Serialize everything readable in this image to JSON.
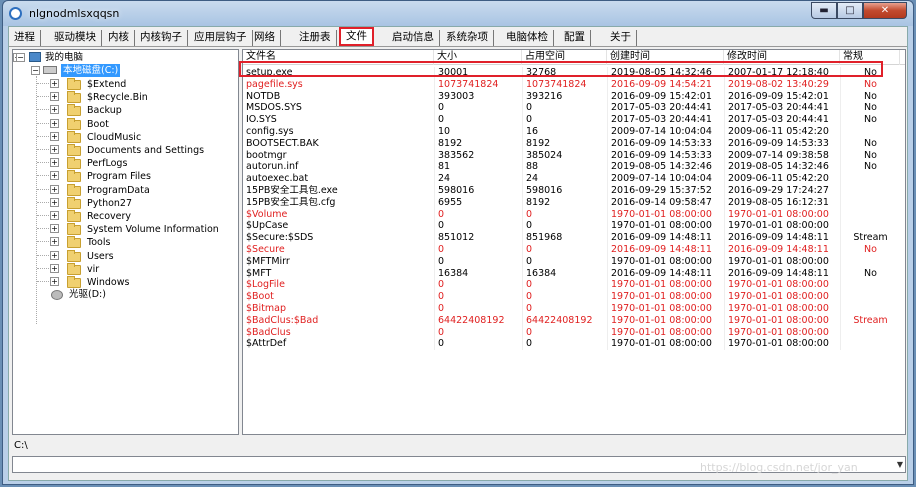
{
  "window": {
    "title": "nlgnodmlsxqqsn",
    "ctrl_min": "▬",
    "ctrl_max": "□",
    "ctrl_close": "✕"
  },
  "tabs": [
    "进程",
    "驱动模块",
    "内核",
    "内核钩子",
    "应用层钩子",
    "网络",
    "注册表",
    "文件",
    "启动信息",
    "系统杂项",
    "电脑体检",
    "配置",
    "关于"
  ],
  "active_tab": "文件",
  "tree": {
    "root": "我的电脑",
    "drive": "本地磁盘(C:)",
    "folders": [
      "$Extend",
      "$Recycle.Bin",
      "Backup",
      "Boot",
      "CloudMusic",
      "Documents and Settings",
      "PerfLogs",
      "Program Files",
      "ProgramData",
      "Python27",
      "Recovery",
      "System Volume Information",
      "Tools",
      "Users",
      "vir",
      "Windows"
    ],
    "cdrom": "光驱(D:)"
  },
  "columns": [
    "文件名",
    "大小",
    "占用空间",
    "创建时间",
    "修改时间",
    "常规"
  ],
  "files": [
    {
      "name": "setup.exe",
      "size": "30001",
      "space": "32768",
      "created": "2019-08-05 14:32:46",
      "modified": "2007-01-17 12:18:40",
      "normal": "No",
      "red": false
    },
    {
      "name": "pagefile.sys",
      "size": "1073741824",
      "space": "1073741824",
      "created": "2016-09-09 14:54:21",
      "modified": "2019-08-02 13:40:29",
      "normal": "No",
      "red": true
    },
    {
      "name": "NOTDB",
      "size": "393003",
      "space": "393216",
      "created": "2016-09-09 15:42:01",
      "modified": "2016-09-09 15:42:01",
      "normal": "No",
      "red": false
    },
    {
      "name": "MSDOS.SYS",
      "size": "0",
      "space": "0",
      "created": "2017-05-03 20:44:41",
      "modified": "2017-05-03 20:44:41",
      "normal": "No",
      "red": false
    },
    {
      "name": "IO.SYS",
      "size": "0",
      "space": "0",
      "created": "2017-05-03 20:44:41",
      "modified": "2017-05-03 20:44:41",
      "normal": "No",
      "red": false
    },
    {
      "name": "config.sys",
      "size": "10",
      "space": "16",
      "created": "2009-07-14 10:04:04",
      "modified": "2009-06-11 05:42:20",
      "normal": "",
      "red": false
    },
    {
      "name": "BOOTSECT.BAK",
      "size": "8192",
      "space": "8192",
      "created": "2016-09-09 14:53:33",
      "modified": "2016-09-09 14:53:33",
      "normal": "No",
      "red": false
    },
    {
      "name": "bootmgr",
      "size": "383562",
      "space": "385024",
      "created": "2016-09-09 14:53:33",
      "modified": "2009-07-14 09:38:58",
      "normal": "No",
      "red": false
    },
    {
      "name": "autorun.inf",
      "size": "81",
      "space": "88",
      "created": "2019-08-05 14:32:46",
      "modified": "2019-08-05 14:32:46",
      "normal": "No",
      "red": false
    },
    {
      "name": "autoexec.bat",
      "size": "24",
      "space": "24",
      "created": "2009-07-14 10:04:04",
      "modified": "2009-06-11 05:42:20",
      "normal": "",
      "red": false
    },
    {
      "name": "15PB安全工具包.exe",
      "size": "598016",
      "space": "598016",
      "created": "2016-09-29 15:37:52",
      "modified": "2016-09-29 17:24:27",
      "normal": "",
      "red": false
    },
    {
      "name": "15PB安全工具包.cfg",
      "size": "6955",
      "space": "8192",
      "created": "2016-09-14 09:58:47",
      "modified": "2019-08-05 16:12:31",
      "normal": "",
      "red": false
    },
    {
      "name": "$Volume",
      "size": "0",
      "space": "0",
      "created": "1970-01-01 08:00:00",
      "modified": "1970-01-01 08:00:00",
      "normal": "",
      "red": true
    },
    {
      "name": "$UpCase",
      "size": "0",
      "space": "0",
      "created": "1970-01-01 08:00:00",
      "modified": "1970-01-01 08:00:00",
      "normal": "",
      "red": false
    },
    {
      "name": "$Secure:$SDS",
      "size": "851012",
      "space": "851968",
      "created": "2016-09-09 14:48:11",
      "modified": "2016-09-09 14:48:11",
      "normal": "Stream",
      "red": false
    },
    {
      "name": "$Secure",
      "size": "0",
      "space": "0",
      "created": "2016-09-09 14:48:11",
      "modified": "2016-09-09 14:48:11",
      "normal": "No",
      "red": true
    },
    {
      "name": "$MFTMirr",
      "size": "0",
      "space": "0",
      "created": "1970-01-01 08:00:00",
      "modified": "1970-01-01 08:00:00",
      "normal": "",
      "red": false
    },
    {
      "name": "$MFT",
      "size": "16384",
      "space": "16384",
      "created": "2016-09-09 14:48:11",
      "modified": "2016-09-09 14:48:11",
      "normal": "No",
      "red": false
    },
    {
      "name": "$LogFile",
      "size": "0",
      "space": "0",
      "created": "1970-01-01 08:00:00",
      "modified": "1970-01-01 08:00:00",
      "normal": "",
      "red": true
    },
    {
      "name": "$Boot",
      "size": "0",
      "space": "0",
      "created": "1970-01-01 08:00:00",
      "modified": "1970-01-01 08:00:00",
      "normal": "",
      "red": true
    },
    {
      "name": "$Bitmap",
      "size": "0",
      "space": "0",
      "created": "1970-01-01 08:00:00",
      "modified": "1970-01-01 08:00:00",
      "normal": "",
      "red": true
    },
    {
      "name": "$BadClus:$Bad",
      "size": "64422408192",
      "space": "64422408192",
      "created": "1970-01-01 08:00:00",
      "modified": "1970-01-01 08:00:00",
      "normal": "Stream",
      "red": true
    },
    {
      "name": "$BadClus",
      "size": "0",
      "space": "0",
      "created": "1970-01-01 08:00:00",
      "modified": "1970-01-01 08:00:00",
      "normal": "",
      "red": true
    },
    {
      "name": "$AttrDef",
      "size": "0",
      "space": "0",
      "created": "1970-01-01 08:00:00",
      "modified": "1970-01-01 08:00:00",
      "normal": "",
      "red": false
    }
  ],
  "status_path": "C:\\",
  "watermark": "https://blog.csdn.net/jor_yan"
}
